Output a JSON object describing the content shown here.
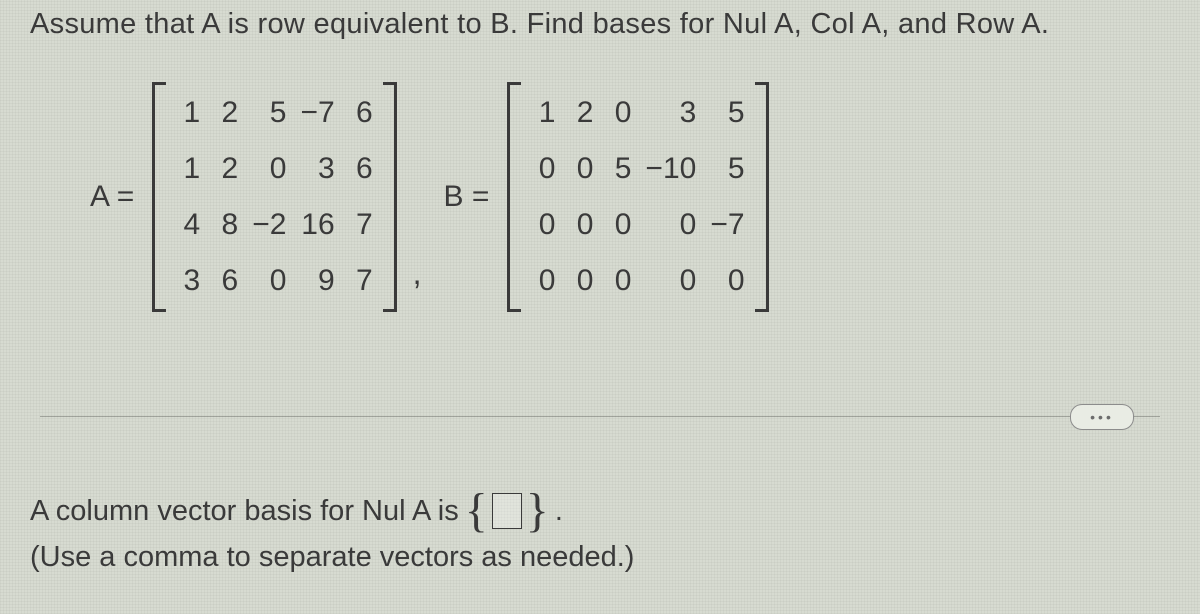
{
  "question_text": "Assume that A is row equivalent to B. Find bases for Nul A, Col A, and Row A.",
  "matrixA": {
    "label": "A =",
    "cols": 5,
    "cells": [
      "1",
      "2",
      "5",
      "−7",
      "6",
      "1",
      "2",
      "0",
      "3",
      "6",
      "4",
      "8",
      "−2",
      "16",
      "7",
      "3",
      "6",
      "0",
      "9",
      "7"
    ]
  },
  "matrixB": {
    "label": "B =",
    "cols": 5,
    "cells": [
      "1",
      "2",
      "0",
      "3",
      "5",
      "0",
      "0",
      "5",
      "−10",
      "5",
      "0",
      "0",
      "0",
      "0",
      "−7",
      "0",
      "0",
      "0",
      "0",
      "0"
    ]
  },
  "separator_comma": ",",
  "ellipsis_label": "•••",
  "answer": {
    "prompt_before": "A column vector basis for Nul A is",
    "brace_open": "{",
    "brace_close": "}",
    "period": ".",
    "hint": "(Use a comma to separate vectors as needed.)",
    "input_value": ""
  }
}
